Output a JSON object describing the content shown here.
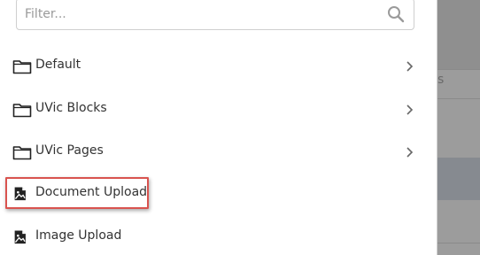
{
  "filter": {
    "placeholder": "Filter...",
    "value": "",
    "icon": "search-icon"
  },
  "backdrop": {
    "partial_text": "s"
  },
  "items": [
    {
      "label": "Default",
      "icon": "folder-icon",
      "has_children": true
    },
    {
      "label": "UVic Blocks",
      "icon": "folder-icon",
      "has_children": true
    },
    {
      "label": "UVic Pages",
      "icon": "folder-icon",
      "has_children": true
    },
    {
      "label": "Document Upload",
      "icon": "file-image-icon",
      "has_children": false,
      "highlighted": true
    },
    {
      "label": "Image Upload",
      "icon": "file-image-icon",
      "has_children": false
    }
  ],
  "colors": {
    "highlight_border": "#d9534f",
    "text": "#333333",
    "backdrop": "#8f8f8f"
  }
}
